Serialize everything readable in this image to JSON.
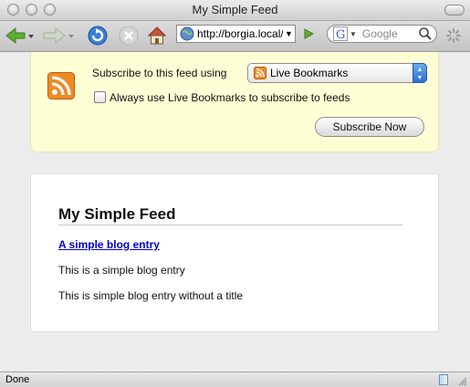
{
  "window": {
    "title": "My Simple Feed"
  },
  "toolbar": {
    "url": "http://borgia.local/simplefeed",
    "search_placeholder": "Google"
  },
  "subscribe": {
    "label": "Subscribe to this feed using",
    "reader": "Live Bookmarks",
    "always_label": "Always use Live Bookmarks to subscribe to feeds",
    "always_checked": false,
    "button_label": "Subscribe Now"
  },
  "feed": {
    "title": "My Simple Feed",
    "entries": [
      {
        "title": "A simple blog entry",
        "body": "This is a simple blog entry"
      },
      {
        "title": "",
        "body": "This is simple blog entry without a title"
      }
    ]
  },
  "status": {
    "text": "Done"
  },
  "colors": {
    "rss_orange": "#f08a24",
    "link_blue": "#0000cc",
    "notice_bg": "#ffffd5"
  }
}
